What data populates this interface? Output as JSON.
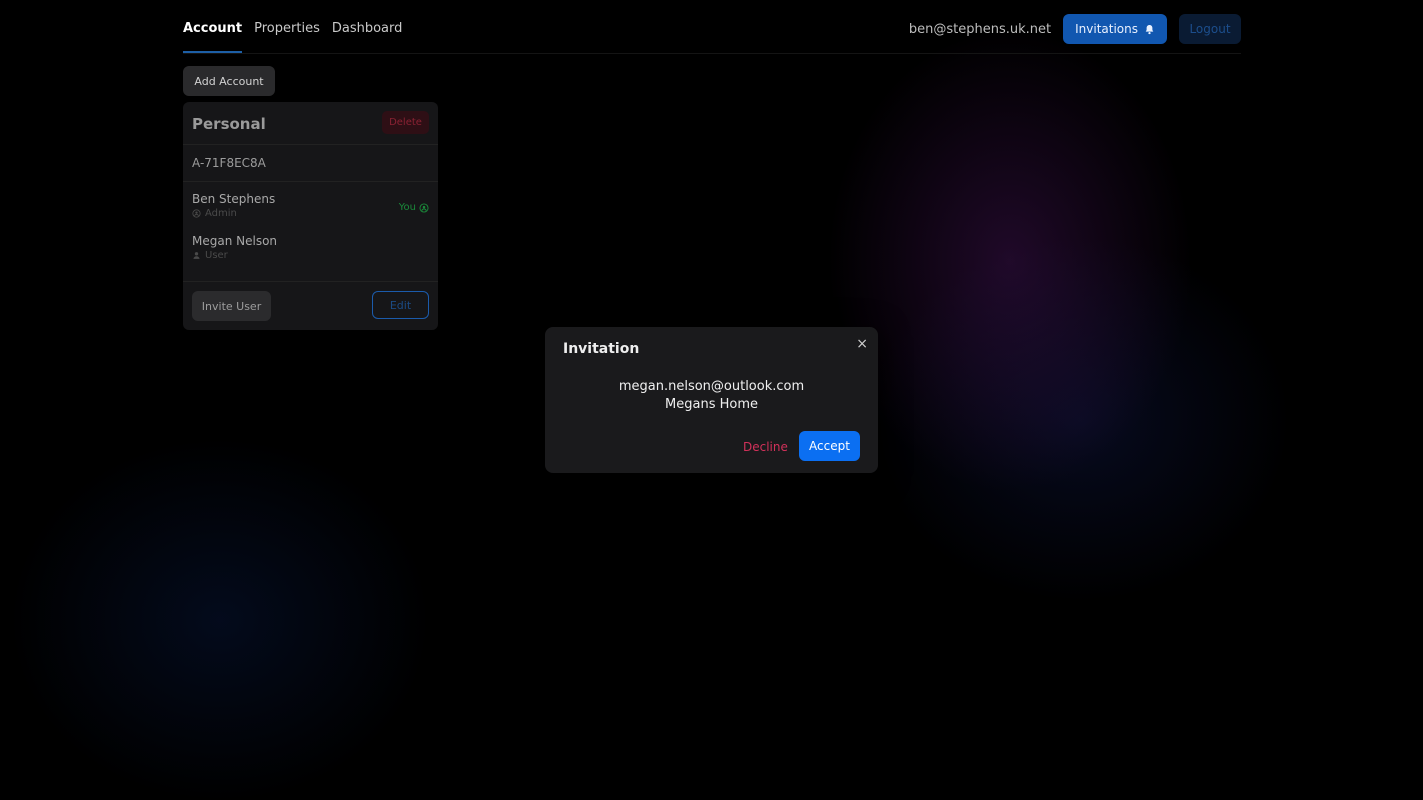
{
  "nav": {
    "tabs": [
      {
        "label": "Account",
        "active": true
      },
      {
        "label": "Properties",
        "active": false
      },
      {
        "label": "Dashboard",
        "active": false
      }
    ],
    "user_email": "ben@stephens.uk.net",
    "invitations_label": "Invitations",
    "logout_label": "Logout"
  },
  "add_account_label": "Add Account",
  "account": {
    "title": "Personal",
    "delete_label": "Delete",
    "id": "A-71F8EC8A",
    "members": [
      {
        "name": "Ben Stephens",
        "role": "Admin",
        "badge": "You"
      },
      {
        "name": "Megan Nelson",
        "role": "User"
      }
    ],
    "invite_user_label": "Invite User",
    "edit_label": "Edit"
  },
  "modal": {
    "title": "Invitation",
    "close": "×",
    "email": "megan.nelson@outlook.com",
    "home": "Megans Home",
    "decline_label": "Decline",
    "accept_label": "Accept"
  },
  "colors": {
    "accent": "#0b6ff2",
    "danger": "#d2315a",
    "success": "#1a8a3a"
  }
}
